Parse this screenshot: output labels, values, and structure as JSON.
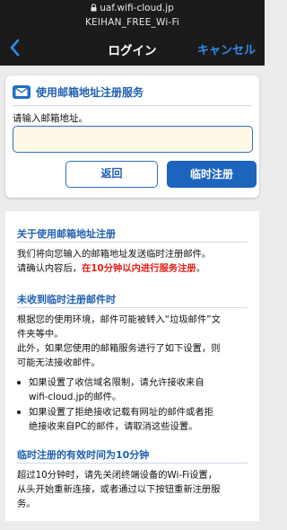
{
  "status_bar": {
    "url": "uaf.wifi-cloud.jp",
    "ssid": "KEIHAN_FREE_Wi-Fi"
  },
  "nav": {
    "title": "ログイン",
    "cancel_label": "キャンセル"
  },
  "register_card": {
    "title": "使用邮箱地址注册服务",
    "email_label": "请输入邮箱地址。",
    "email_value": "",
    "back_label": "返回",
    "register_label": "临时注册"
  },
  "info": {
    "section1": {
      "heading": "关于使用邮箱地址注册",
      "line1": "我们将向您输入的邮箱地址发送临时注册邮件。",
      "line2_prefix": "请确认内容后，",
      "line2_emphasis": "在10分钟以内进行服务注册",
      "line2_suffix": "。"
    },
    "section2": {
      "heading": "未收到临时注册邮件时",
      "line1": "根据您的使用环境，邮件可能被转入“垃圾邮件”文",
      "line2": "件夹等中。",
      "line3": "此外，如果您使用的邮箱服务进行了如下设置，则",
      "line4": "可能无法接收邮件。",
      "bullets": [
        {
          "line1": "如果设置了收信域名限制，请允许接收来自",
          "line2": "wifi-cloud.jp的邮件。"
        },
        {
          "line1": "如果设置了拒绝接收记载有网址的邮件或者拒",
          "line2": "绝接收来自PC的邮件，请取消这些设置。"
        }
      ]
    },
    "section3": {
      "heading": "临时注册的有效时间为10分钟",
      "line1": "超过10分钟时，请先关闭终端设备的Wi-Fi设置，",
      "line2": "从头开始重新连接，或者通过以下按钮重新注册服",
      "line3": "务。"
    }
  },
  "colors": {
    "accent": "#1f5fb0",
    "primary_button": "#1d64bf",
    "cancel": "#2d8cf0",
    "emphasis_red": "#e0221c",
    "input_bg": "#fdf9e6"
  }
}
